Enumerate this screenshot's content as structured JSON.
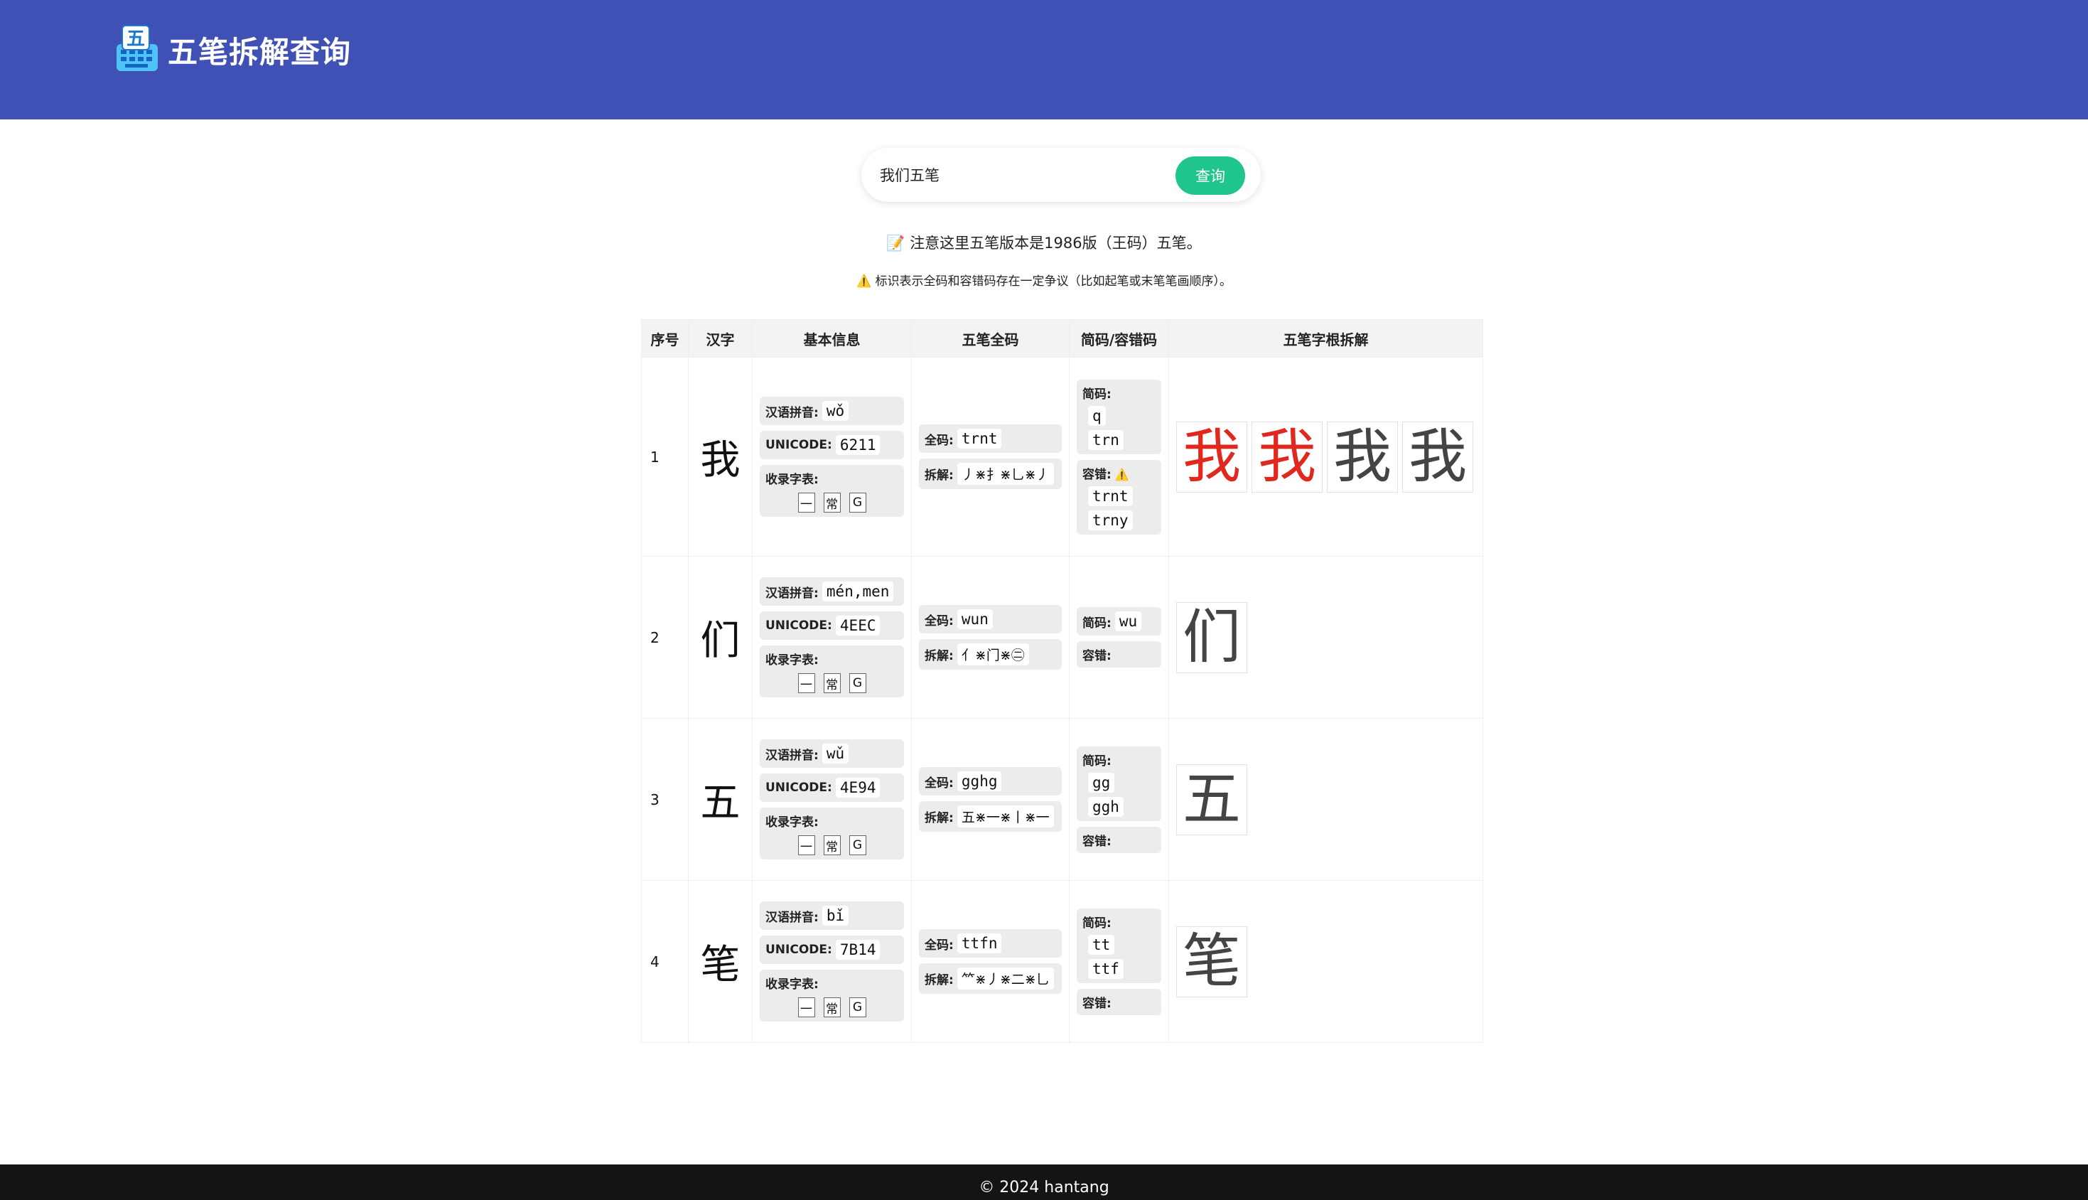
{
  "app": {
    "title": "五笔拆解查询",
    "logo_letter": "五"
  },
  "search": {
    "value": "我们五笔",
    "button_label": "查询"
  },
  "notes": {
    "version_icon": "memo-icon",
    "version": "注意这里五笔版本是1986版（王码）五笔。",
    "warning_icon": "warning-icon",
    "warning": "标识表示全码和容错码存在一定争议（比如起笔或末笔笔画顺序）。"
  },
  "table": {
    "headers": [
      "序号",
      "汉字",
      "基本信息",
      "五笔全码",
      "简码/容错码",
      "五笔字根拆解"
    ],
    "labels": {
      "pinyin": "汉语拼音:",
      "unicode": "UNICODE:",
      "charset": "收录字表:",
      "full": "全码:",
      "decomp": "拆解:",
      "short": "简码:",
      "fault": "容错:"
    },
    "charset_tags": [
      "一",
      "常",
      "G"
    ],
    "rows": [
      {
        "index": "1",
        "char": "我",
        "pinyin": "wǒ",
        "unicode": "6211",
        "full_code": "trnt",
        "decomp": "丿⋇扌⋇乚⋇丿",
        "short_codes": [
          "q",
          "trn"
        ],
        "fault_codes": [
          "trnt",
          "trny"
        ],
        "fault_warning": true,
        "glyphs": [
          "我",
          "我",
          "我",
          "我"
        ]
      },
      {
        "index": "2",
        "char": "们",
        "pinyin": "mén,men",
        "unicode": "4EEC",
        "full_code": "wun",
        "decomp": "亻⋇门⋇㊁",
        "short_codes": [
          "wu"
        ],
        "fault_codes": [],
        "fault_warning": false,
        "glyphs": [
          "们"
        ]
      },
      {
        "index": "3",
        "char": "五",
        "pinyin": "wǔ",
        "unicode": "4E94",
        "full_code": "gghg",
        "decomp": "五⋇一⋇丨⋇一",
        "short_codes": [
          "gg",
          "ggh"
        ],
        "fault_codes": [],
        "fault_warning": false,
        "glyphs": [
          "五"
        ]
      },
      {
        "index": "4",
        "char": "笔",
        "pinyin": "bǐ",
        "unicode": "7B14",
        "full_code": "ttfn",
        "decomp": "⺮⋇丿⋇二⋇乚",
        "short_codes": [
          "tt",
          "ttf"
        ],
        "fault_codes": [],
        "fault_warning": false,
        "glyphs": [
          "笔"
        ]
      }
    ]
  },
  "footer": {
    "text": "© 2024 hantang"
  },
  "colors": {
    "header": "#3f51b5",
    "button": "#1fc58b",
    "highlight": "#e0281e",
    "footer": "#141414"
  }
}
